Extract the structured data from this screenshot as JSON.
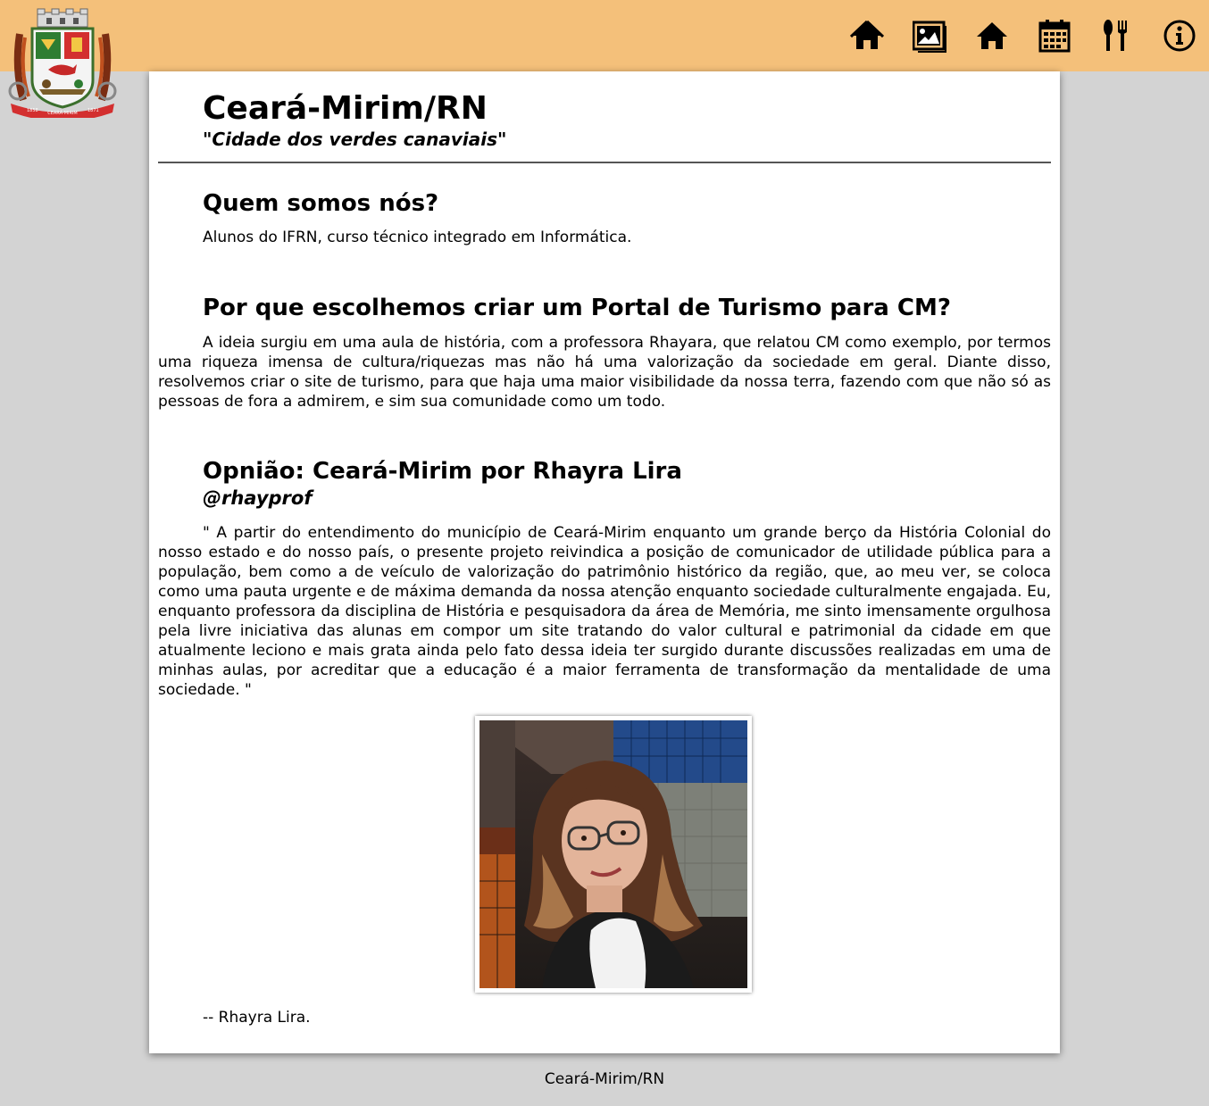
{
  "header": {
    "logo_alt": "Brasão de Ceará-Mirim",
    "logo_ribbon": [
      "1858",
      "CEARÁ-MIRIM",
      "1871"
    ],
    "nav": [
      {
        "icon": "home-icon",
        "name": "nav-home-button"
      },
      {
        "icon": "image-gallery-icon",
        "name": "nav-gallery-button"
      },
      {
        "icon": "house-icon",
        "name": "nav-places-button"
      },
      {
        "icon": "calendar-icon",
        "name": "nav-events-button"
      },
      {
        "icon": "fork-knife-icon",
        "name": "nav-food-button"
      },
      {
        "icon": "info-icon",
        "name": "nav-about-button"
      }
    ]
  },
  "page": {
    "title": "Ceará-Mirim/RN",
    "tagline": "\"Cidade dos verdes canaviais\""
  },
  "sections": {
    "who": {
      "heading": "Quem somos nós?",
      "text": "Alunos do IFRN, curso técnico integrado em Informática."
    },
    "why": {
      "heading": "Por que escolhemos criar um Portal de Turismo para CM?",
      "text": "A ideia surgiu em uma aula de história, com a professora Rhayara, que relatou CM como exemplo, por termos uma riqueza imensa de cultura/riquezas mas não há uma valorização da sociedade em geral. Diante disso, resolvemos criar o site de turismo, para que haja uma maior visibilidade da nossa terra, fazendo com que não só as pessoas de fora a admirem, e sim sua comunidade como um todo."
    },
    "opinion": {
      "heading": "Opnião: Ceará-Mirim por Rhayra Lira",
      "handle": "@rhayprof",
      "quote": "\" A partir do entendimento do município de Ceará-Mirim enquanto um grande berço da História Colonial do nosso estado e do nosso país, o presente projeto reivindica a posição de comunicador de utilidade pública para a população, bem como a de veículo de valorização do patrimônio histórico da região, que, ao meu ver, se coloca como uma pauta urgente e de máxima demanda da nossa atenção enquanto sociedade culturalmente engajada. Eu, enquanto professora da disciplina de História e pesquisadora da área de Memória, me sinto imensamente orgulhosa pela livre iniciativa das alunas em compor um site tratando do valor cultural e patrimonial da cidade em que atualmente leciono e mais grata ainda pelo fato dessa ideia ter surgido durante discussões realizadas em uma de minhas aulas, por acreditar que a educação é a maior ferramenta de transformação da mentalidade de uma sociedade. \"",
      "signature": "-- Rhayra Lira."
    }
  },
  "footer": {
    "text": "Ceará-Mirim/RN"
  },
  "colors": {
    "topbar": "#f4c07a",
    "background": "#d3d3d3",
    "card": "#ffffff"
  }
}
